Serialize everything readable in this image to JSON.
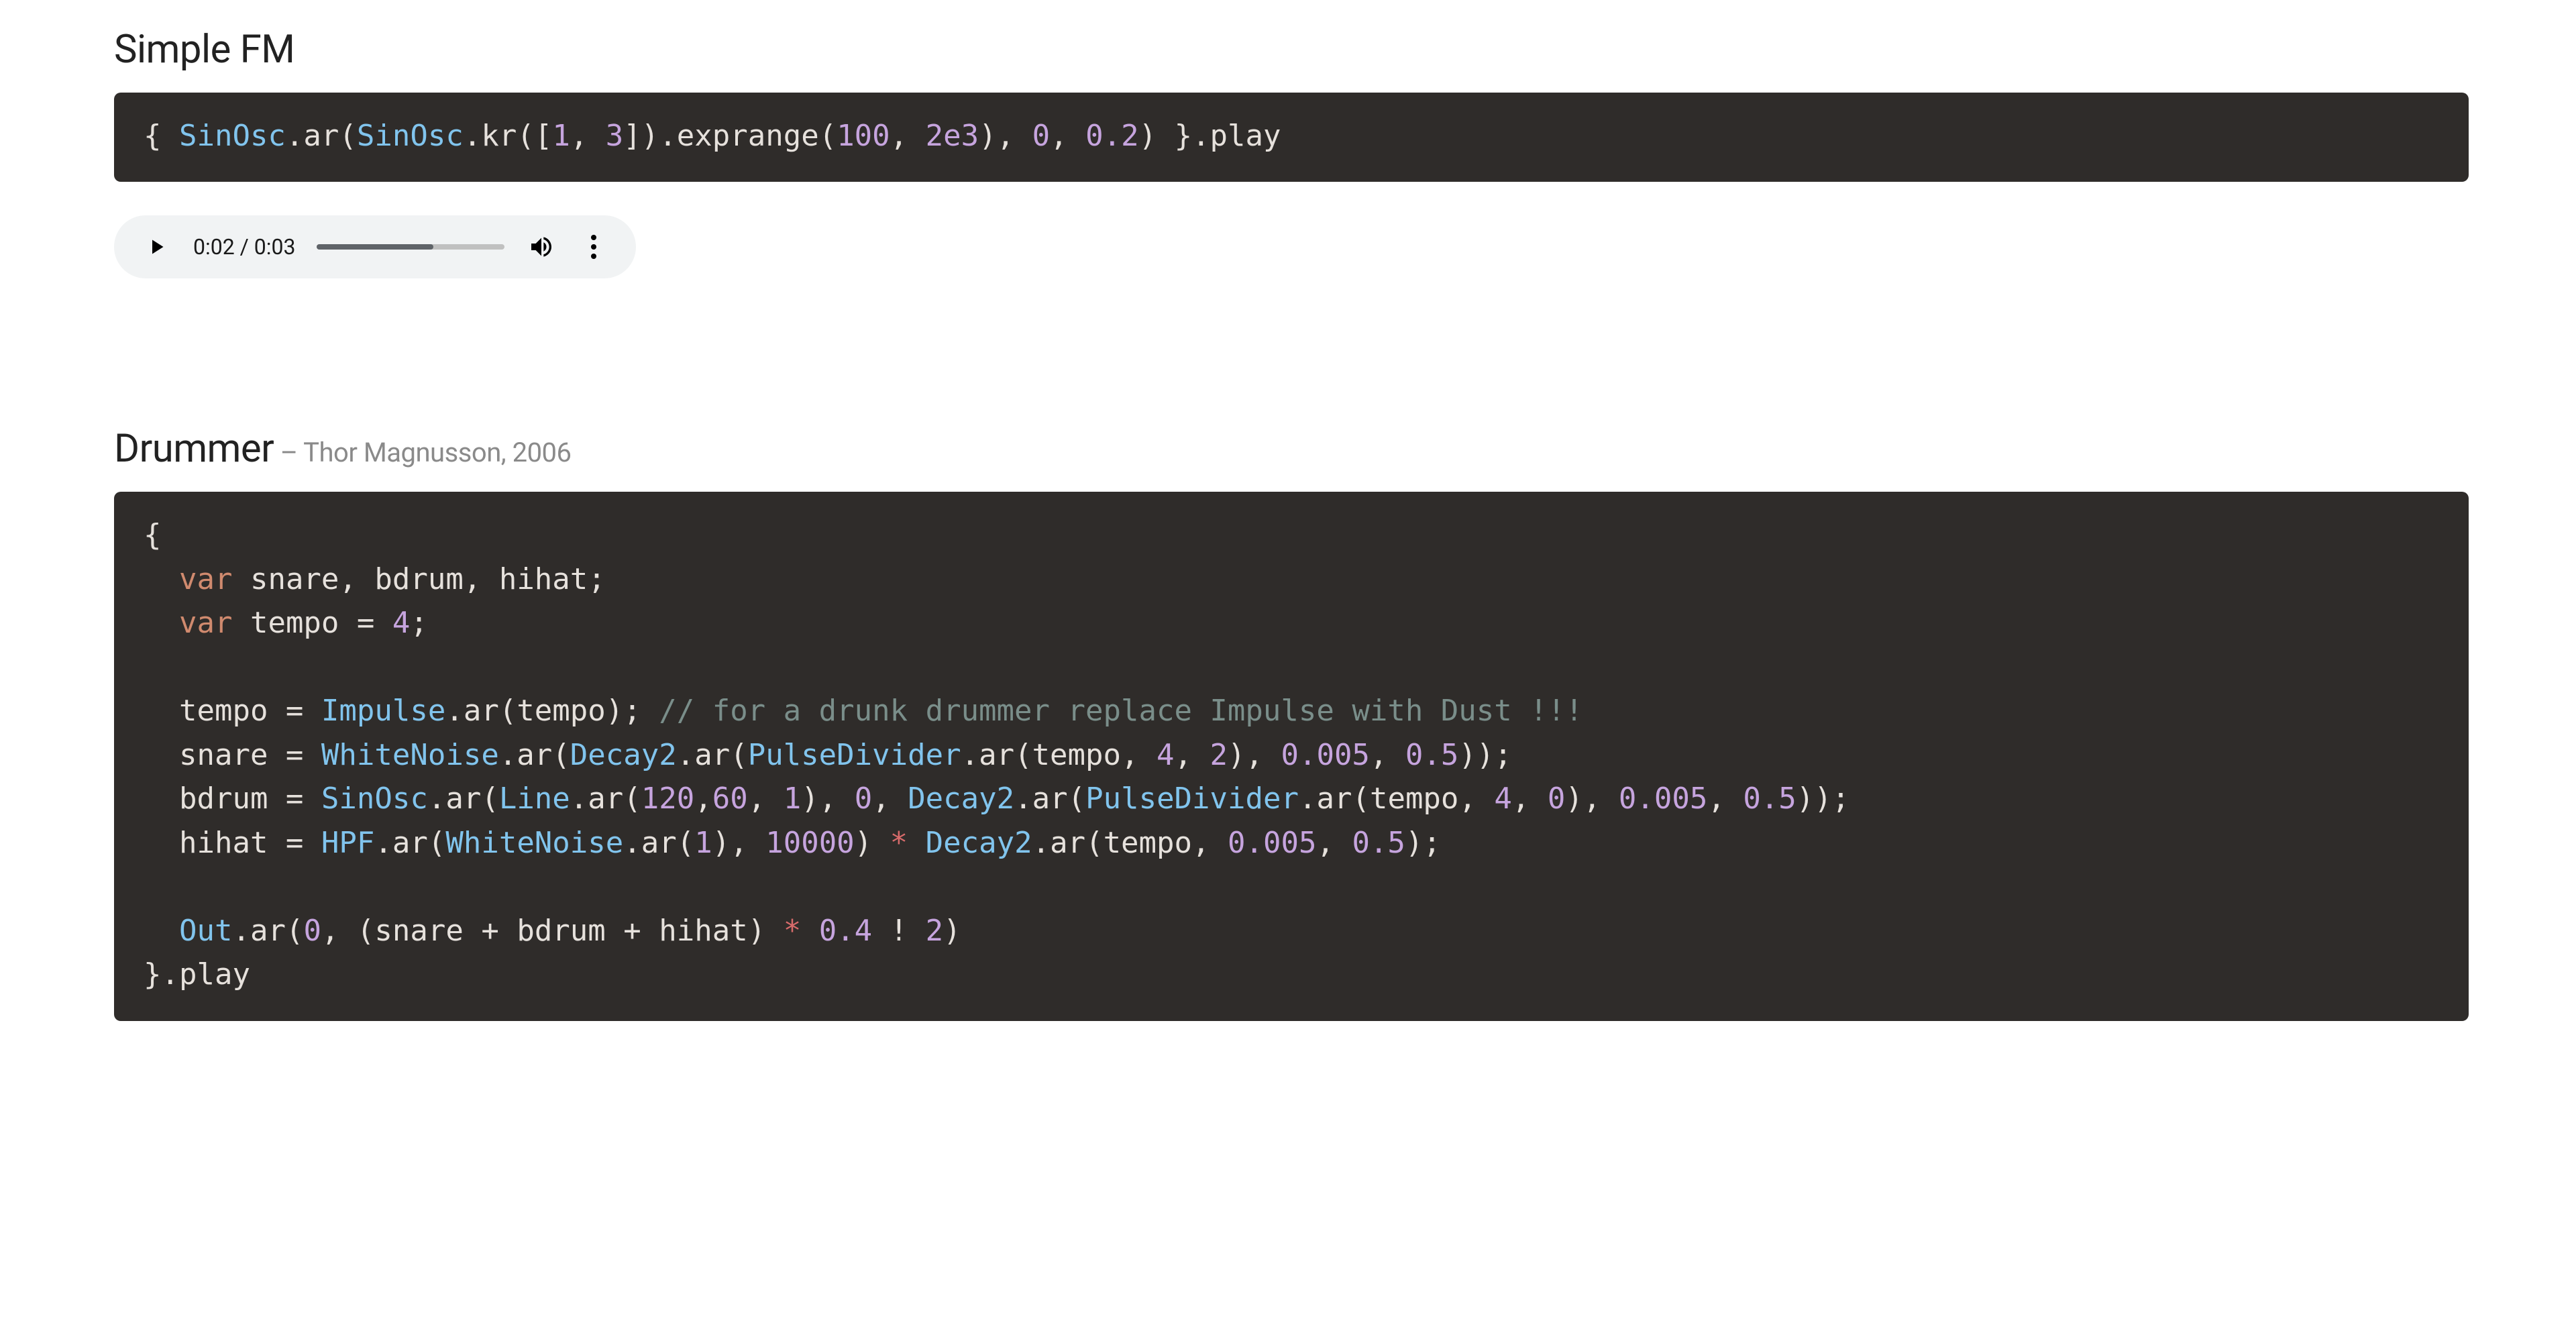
{
  "section1": {
    "title": "Simple FM",
    "code_tokens": [
      {
        "t": "{ ",
        "c": "tok-plain"
      },
      {
        "t": "SinOsc",
        "c": "tok-class"
      },
      {
        "t": ".ar(",
        "c": "tok-method"
      },
      {
        "t": "SinOsc",
        "c": "tok-class"
      },
      {
        "t": ".kr([",
        "c": "tok-method"
      },
      {
        "t": "1",
        "c": "tok-num"
      },
      {
        "t": ", ",
        "c": "tok-plain"
      },
      {
        "t": "3",
        "c": "tok-num"
      },
      {
        "t": "]).exprange(",
        "c": "tok-method"
      },
      {
        "t": "100",
        "c": "tok-num"
      },
      {
        "t": ", ",
        "c": "tok-plain"
      },
      {
        "t": "2e3",
        "c": "tok-num"
      },
      {
        "t": "), ",
        "c": "tok-method"
      },
      {
        "t": "0",
        "c": "tok-num"
      },
      {
        "t": ", ",
        "c": "tok-plain"
      },
      {
        "t": "0.2",
        "c": "tok-num"
      },
      {
        "t": ") }.play",
        "c": "tok-method"
      }
    ],
    "audio": {
      "current": "0:02",
      "total": "0:03",
      "time_sep": " / ",
      "progress_pct": 62
    }
  },
  "section2": {
    "title": "Drummer",
    "subtitle": " – Thor Magnusson, 2006",
    "code_tokens": [
      {
        "t": "{\n",
        "c": "tok-plain"
      },
      {
        "t": "  ",
        "c": "tok-plain"
      },
      {
        "t": "var",
        "c": "tok-keyword"
      },
      {
        "t": " snare, bdrum, hihat;\n",
        "c": "tok-plain"
      },
      {
        "t": "  ",
        "c": "tok-plain"
      },
      {
        "t": "var",
        "c": "tok-keyword"
      },
      {
        "t": " tempo = ",
        "c": "tok-plain"
      },
      {
        "t": "4",
        "c": "tok-num"
      },
      {
        "t": ";\n",
        "c": "tok-plain"
      },
      {
        "t": "\n",
        "c": "tok-plain"
      },
      {
        "t": "  tempo = ",
        "c": "tok-plain"
      },
      {
        "t": "Impulse",
        "c": "tok-class"
      },
      {
        "t": ".ar(tempo); ",
        "c": "tok-method"
      },
      {
        "t": "// for a drunk drummer replace Impulse with Dust !!!",
        "c": "tok-comment"
      },
      {
        "t": "\n",
        "c": "tok-plain"
      },
      {
        "t": "  snare = ",
        "c": "tok-plain"
      },
      {
        "t": "WhiteNoise",
        "c": "tok-class"
      },
      {
        "t": ".ar(",
        "c": "tok-method"
      },
      {
        "t": "Decay2",
        "c": "tok-class"
      },
      {
        "t": ".ar(",
        "c": "tok-method"
      },
      {
        "t": "PulseDivider",
        "c": "tok-class"
      },
      {
        "t": ".ar(tempo, ",
        "c": "tok-method"
      },
      {
        "t": "4",
        "c": "tok-num"
      },
      {
        "t": ", ",
        "c": "tok-plain"
      },
      {
        "t": "2",
        "c": "tok-num"
      },
      {
        "t": "), ",
        "c": "tok-method"
      },
      {
        "t": "0.005",
        "c": "tok-num"
      },
      {
        "t": ", ",
        "c": "tok-plain"
      },
      {
        "t": "0.5",
        "c": "tok-num"
      },
      {
        "t": "));\n",
        "c": "tok-method"
      },
      {
        "t": "  bdrum = ",
        "c": "tok-plain"
      },
      {
        "t": "SinOsc",
        "c": "tok-class"
      },
      {
        "t": ".ar(",
        "c": "tok-method"
      },
      {
        "t": "Line",
        "c": "tok-class"
      },
      {
        "t": ".ar(",
        "c": "tok-method"
      },
      {
        "t": "120",
        "c": "tok-num"
      },
      {
        "t": ",",
        "c": "tok-plain"
      },
      {
        "t": "60",
        "c": "tok-num"
      },
      {
        "t": ", ",
        "c": "tok-plain"
      },
      {
        "t": "1",
        "c": "tok-num"
      },
      {
        "t": "), ",
        "c": "tok-method"
      },
      {
        "t": "0",
        "c": "tok-num"
      },
      {
        "t": ", ",
        "c": "tok-plain"
      },
      {
        "t": "Decay2",
        "c": "tok-class"
      },
      {
        "t": ".ar(",
        "c": "tok-method"
      },
      {
        "t": "PulseDivider",
        "c": "tok-class"
      },
      {
        "t": ".ar(tempo, ",
        "c": "tok-method"
      },
      {
        "t": "4",
        "c": "tok-num"
      },
      {
        "t": ", ",
        "c": "tok-plain"
      },
      {
        "t": "0",
        "c": "tok-num"
      },
      {
        "t": "), ",
        "c": "tok-method"
      },
      {
        "t": "0.005",
        "c": "tok-num"
      },
      {
        "t": ", ",
        "c": "tok-plain"
      },
      {
        "t": "0.5",
        "c": "tok-num"
      },
      {
        "t": "));\n",
        "c": "tok-method"
      },
      {
        "t": "  hihat = ",
        "c": "tok-plain"
      },
      {
        "t": "HPF",
        "c": "tok-class"
      },
      {
        "t": ".ar(",
        "c": "tok-method"
      },
      {
        "t": "WhiteNoise",
        "c": "tok-class"
      },
      {
        "t": ".ar(",
        "c": "tok-method"
      },
      {
        "t": "1",
        "c": "tok-num"
      },
      {
        "t": "), ",
        "c": "tok-method"
      },
      {
        "t": "10000",
        "c": "tok-num"
      },
      {
        "t": ") ",
        "c": "tok-method"
      },
      {
        "t": "*",
        "c": "tok-star"
      },
      {
        "t": " ",
        "c": "tok-plain"
      },
      {
        "t": "Decay2",
        "c": "tok-class"
      },
      {
        "t": ".ar(tempo, ",
        "c": "tok-method"
      },
      {
        "t": "0.005",
        "c": "tok-num"
      },
      {
        "t": ", ",
        "c": "tok-plain"
      },
      {
        "t": "0.5",
        "c": "tok-num"
      },
      {
        "t": ");\n",
        "c": "tok-method"
      },
      {
        "t": "\n",
        "c": "tok-plain"
      },
      {
        "t": "  ",
        "c": "tok-plain"
      },
      {
        "t": "Out",
        "c": "tok-class"
      },
      {
        "t": ".ar(",
        "c": "tok-method"
      },
      {
        "t": "0",
        "c": "tok-num"
      },
      {
        "t": ", (snare + bdrum + hihat) ",
        "c": "tok-method"
      },
      {
        "t": "*",
        "c": "tok-star"
      },
      {
        "t": " ",
        "c": "tok-plain"
      },
      {
        "t": "0.4",
        "c": "tok-num"
      },
      {
        "t": " ! ",
        "c": "tok-method"
      },
      {
        "t": "2",
        "c": "tok-num"
      },
      {
        "t": ")\n",
        "c": "tok-method"
      },
      {
        "t": "}.play",
        "c": "tok-method"
      }
    ]
  }
}
